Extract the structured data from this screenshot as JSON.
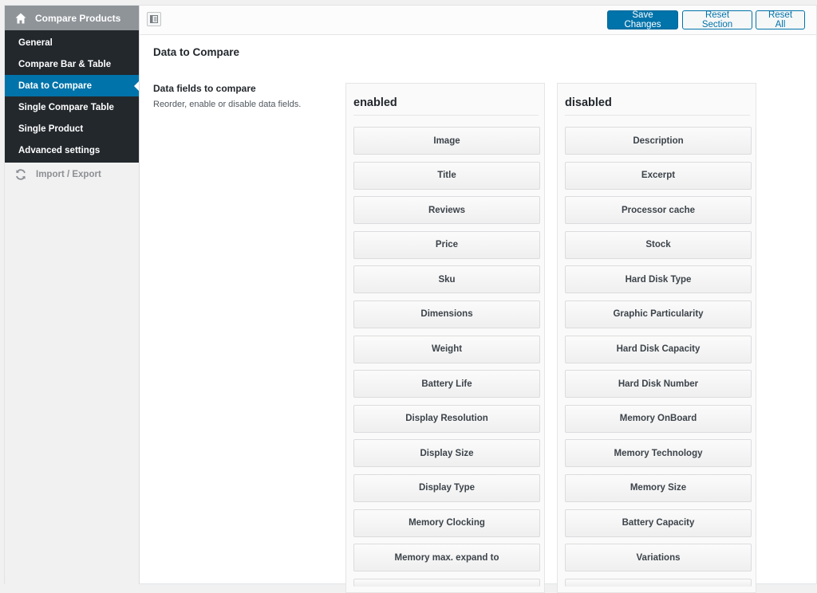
{
  "sidebar": {
    "header_label": "Compare Products",
    "items": [
      {
        "label": "General",
        "active": false
      },
      {
        "label": "Compare Bar & Table",
        "active": false
      },
      {
        "label": "Data to Compare",
        "active": true
      },
      {
        "label": "Single Compare Table",
        "active": false
      },
      {
        "label": "Single Product",
        "active": false
      },
      {
        "label": "Advanced settings",
        "active": false
      }
    ],
    "extra_label": "Import / Export"
  },
  "toolbar": {
    "save_label": "Save Changes",
    "reset_section_label": "Reset Section",
    "reset_all_label": "Reset All"
  },
  "main": {
    "section_title": "Data to Compare",
    "field_label": "Data fields to compare",
    "field_description": "Reorder, enable or disable data fields.",
    "enabled": {
      "heading": "enabled",
      "items": [
        "Image",
        "Title",
        "Reviews",
        "Price",
        "Sku",
        "Dimensions",
        "Weight",
        "Battery Life",
        "Display Resolution",
        "Display Size",
        "Display Type",
        "Memory Clocking",
        "Memory max. expand to"
      ]
    },
    "disabled": {
      "heading": "disabled",
      "items": [
        "Description",
        "Excerpt",
        "Processor cache",
        "Stock",
        "Hard Disk Type",
        "Graphic Particularity",
        "Hard Disk Capacity",
        "Hard Disk Number",
        "Memory OnBoard",
        "Memory Technology",
        "Memory Size",
        "Battery Capacity",
        "Variations"
      ]
    }
  },
  "colors": {
    "accent": "#0073aa",
    "sidebar_bg": "#23282d",
    "sidebar_header_bg": "#8f9499"
  },
  "icons": {
    "header": "home-icon",
    "extra": "sync-icon",
    "panel_toggle": "panel-toggle-icon"
  }
}
